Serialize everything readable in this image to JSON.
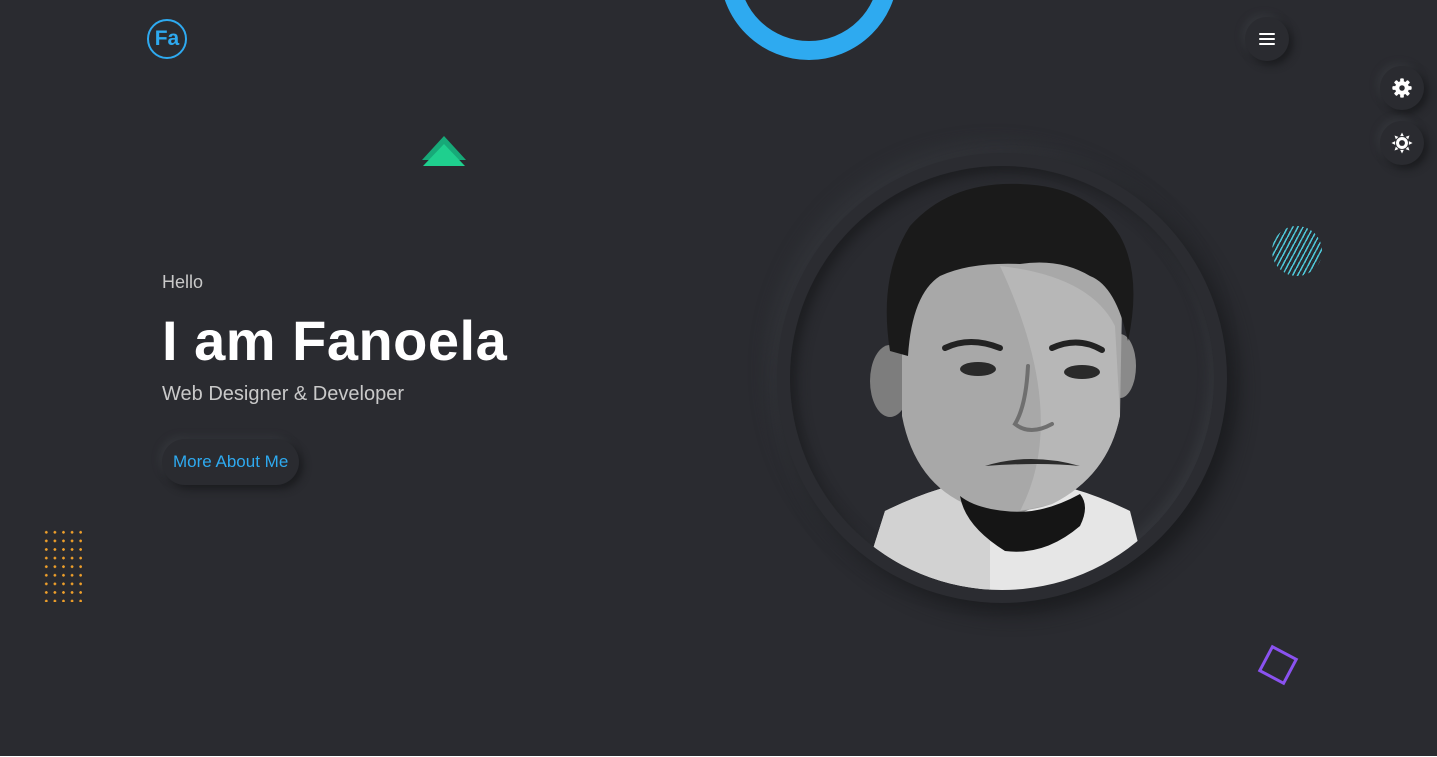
{
  "header": {
    "logo_text": "Fa",
    "menu_icon": "hamburger-menu-icon"
  },
  "side_controls": {
    "settings_icon": "gear-icon",
    "theme_icon": "sun-icon"
  },
  "hero": {
    "greeting": "Hello",
    "name": "I am Fanoela",
    "role": "Web Designer & Developer",
    "cta_label": "More About Me"
  },
  "colors": {
    "background": "#2a2b30",
    "accent": "#2eaaf0",
    "triangle": "#1fcf8e",
    "dots": "#f0a02a",
    "square": "#8a52f0",
    "hatch": "#4fc6d6"
  }
}
